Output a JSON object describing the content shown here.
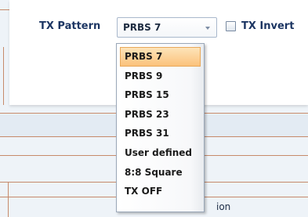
{
  "tx_pattern": {
    "label": "TX Pattern",
    "selected_value": "PRBS 7",
    "options": [
      "PRBS 7",
      "PRBS 9",
      "PRBS 15",
      "PRBS 23",
      "PRBS 31",
      "User defined",
      "8:8 Square",
      "TX OFF"
    ]
  },
  "tx_invert": {
    "label": "TX Invert",
    "checked": false
  },
  "background": {
    "partial_text": "ion"
  },
  "colors": {
    "label_blue": "#1d3663",
    "selection_orange": "#fbc27b",
    "divider_brown": "#c68a6a"
  }
}
